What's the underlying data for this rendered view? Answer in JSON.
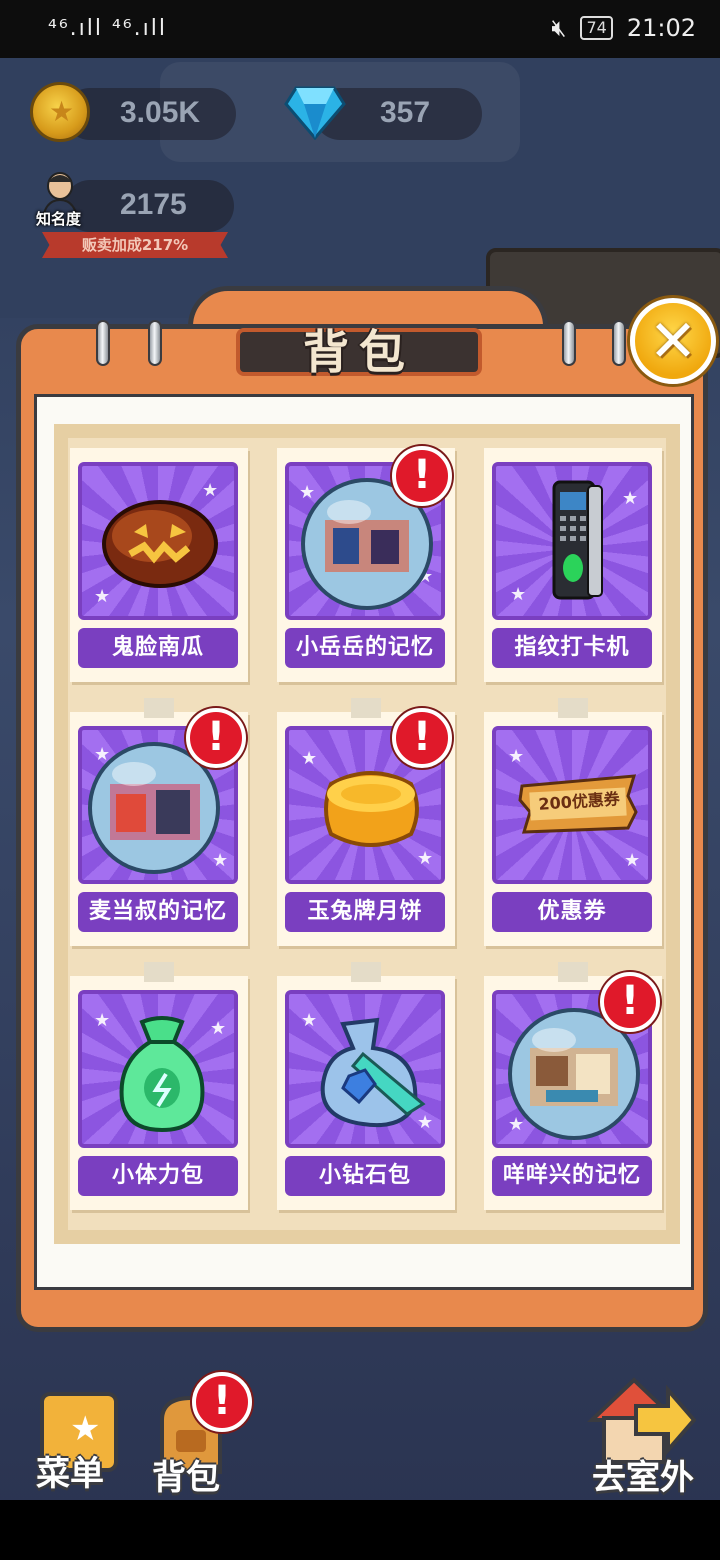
{
  "status_bar": {
    "signal": "⁴⁶.ıll ⁴⁶.ıll",
    "icons": "✻ ▯ ⊚",
    "battery": "74",
    "time": "21:02"
  },
  "hud": {
    "coins": "3.05K",
    "diamonds": "357",
    "fame": "2175",
    "fame_label": "知名度",
    "sell_bonus": "贩卖加成217%"
  },
  "backpack": {
    "title": "背包",
    "close_glyph": "✕",
    "alert_glyph": "!",
    "items": [
      {
        "name": "鬼脸南瓜",
        "icon": "jack-o-lantern-icon",
        "has_alert": false
      },
      {
        "name": "小岳岳的记忆",
        "icon": "memory-orb-icon",
        "has_alert": true
      },
      {
        "name": "指纹打卡机",
        "icon": "fingerprint-scanner-icon",
        "has_alert": false
      },
      {
        "name": "麦当叔的记忆",
        "icon": "memory-orb-icon",
        "has_alert": true
      },
      {
        "name": "玉兔牌月饼",
        "icon": "mooncake-icon",
        "has_alert": true
      },
      {
        "name": "优惠券",
        "icon": "coupon-icon",
        "coupon_text": "200优惠券",
        "has_alert": false
      },
      {
        "name": "小体力包",
        "icon": "stamina-bag-icon",
        "has_alert": false
      },
      {
        "name": "小钻石包",
        "icon": "diamond-bag-icon",
        "has_alert": false
      },
      {
        "name": "咩咩兴的记忆",
        "icon": "memory-orb-icon",
        "has_alert": true
      }
    ]
  },
  "bottom_nav": {
    "menu": "菜单",
    "bag": "背包",
    "go_outside": "去室外"
  },
  "colors": {
    "panel": "#e8894d",
    "card_purple": "#7a3fc0",
    "alert_red": "#e0192a",
    "close_gold": "#f0a80e"
  }
}
